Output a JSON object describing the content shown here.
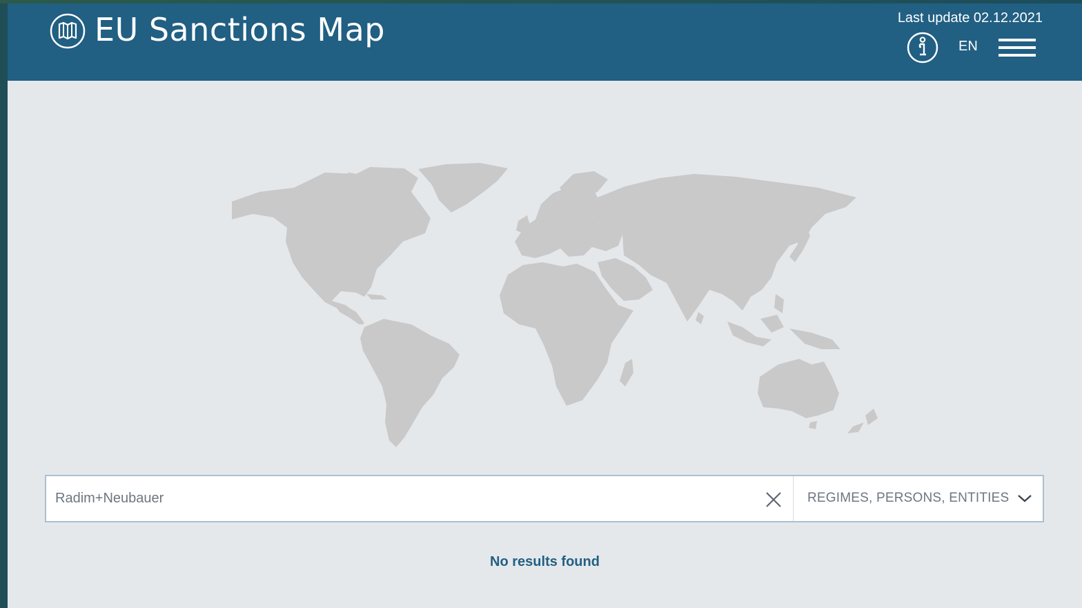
{
  "header": {
    "title": "EU Sanctions Map",
    "last_update": "Last update 02.12.2021",
    "language": "EN",
    "logo_icon": "map-icon",
    "info_icon": "info-icon",
    "menu_icon": "hamburger-menu-icon"
  },
  "search": {
    "value": "Radim+Neubauer",
    "clear_icon": "close-icon"
  },
  "filter": {
    "selected": "REGIMES, PERSONS, ENTITIES",
    "chevron_icon": "chevron-down-icon"
  },
  "results": {
    "message": "No results found"
  },
  "colors": {
    "header_bg": "#215f83",
    "page_bg": "#e5e8eb",
    "land": "#c9c9c9",
    "accent_text": "#215f83"
  }
}
